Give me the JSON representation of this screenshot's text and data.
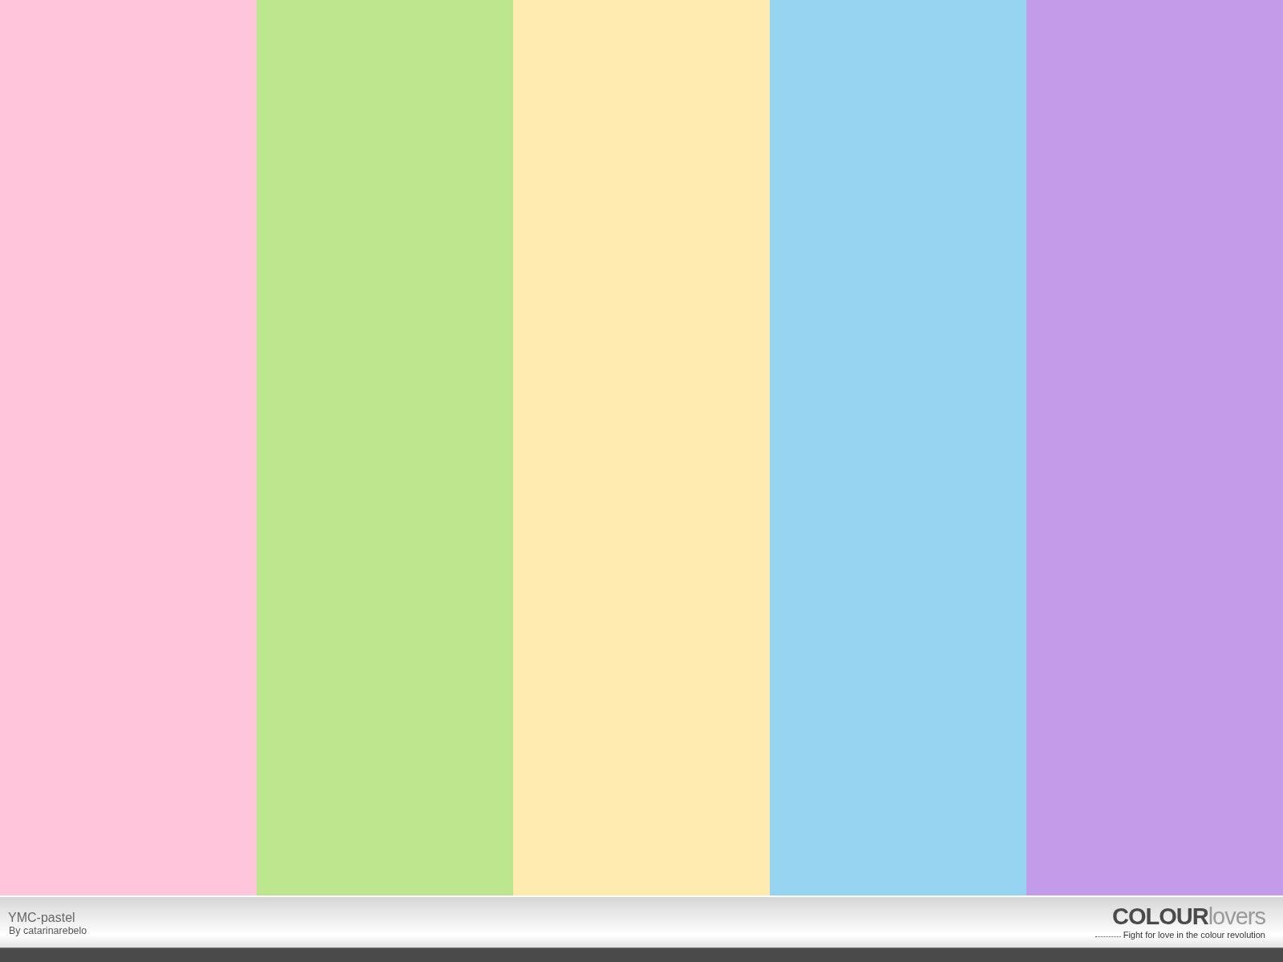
{
  "swatches": [
    {
      "color": "#ffc6db"
    },
    {
      "color": "#bce78f"
    },
    {
      "color": "#ffeab0"
    },
    {
      "color": "#96d4f2"
    },
    {
      "color": "#c29ce9"
    }
  ],
  "footer": {
    "title": "YMC-pastel",
    "author": "By catarinarebelo",
    "logo": {
      "bold": "COLOUR",
      "light": "lovers"
    },
    "tagline": "Fight for love in the colour revolution"
  }
}
